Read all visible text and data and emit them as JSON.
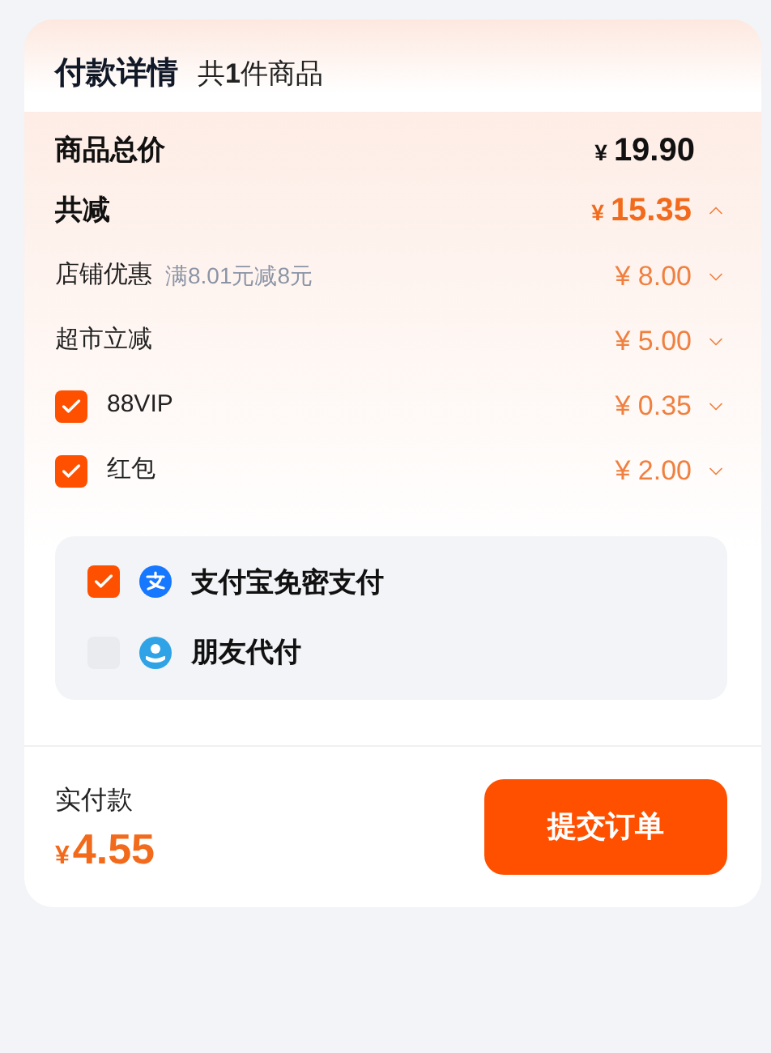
{
  "header": {
    "title": "付款详情",
    "count": "共**1**件商品"
  },
  "total": {
    "label": "商品总价",
    "currency": "¥",
    "amount": "19.90"
  },
  "discount": {
    "label": "共减",
    "currency": "¥",
    "amount": "15.35",
    "expanded": true,
    "items": [
      {
        "kind": "plain",
        "label": "店铺优惠",
        "note": "满8.01元减8元",
        "amount": "¥ 8.00",
        "expanded": false
      },
      {
        "kind": "plain",
        "label": "超市立减",
        "amount": "¥ 5.00",
        "expanded": false
      },
      {
        "kind": "checkbox",
        "label": "88VIP",
        "checked": true,
        "amount": "¥ 0.35",
        "expanded": false
      },
      {
        "kind": "checkbox",
        "label": "红包",
        "checked": true,
        "amount": "¥ 2.00",
        "expanded": false
      }
    ]
  },
  "payment_methods": [
    {
      "kind": "alipay",
      "label": "支付宝免密支付",
      "checked": true
    },
    {
      "kind": "friend",
      "label": "朋友代付",
      "checked": false
    }
  ],
  "footer": {
    "label": "实付款",
    "currency": "¥",
    "amount": "4.55",
    "button": "提交订单"
  }
}
